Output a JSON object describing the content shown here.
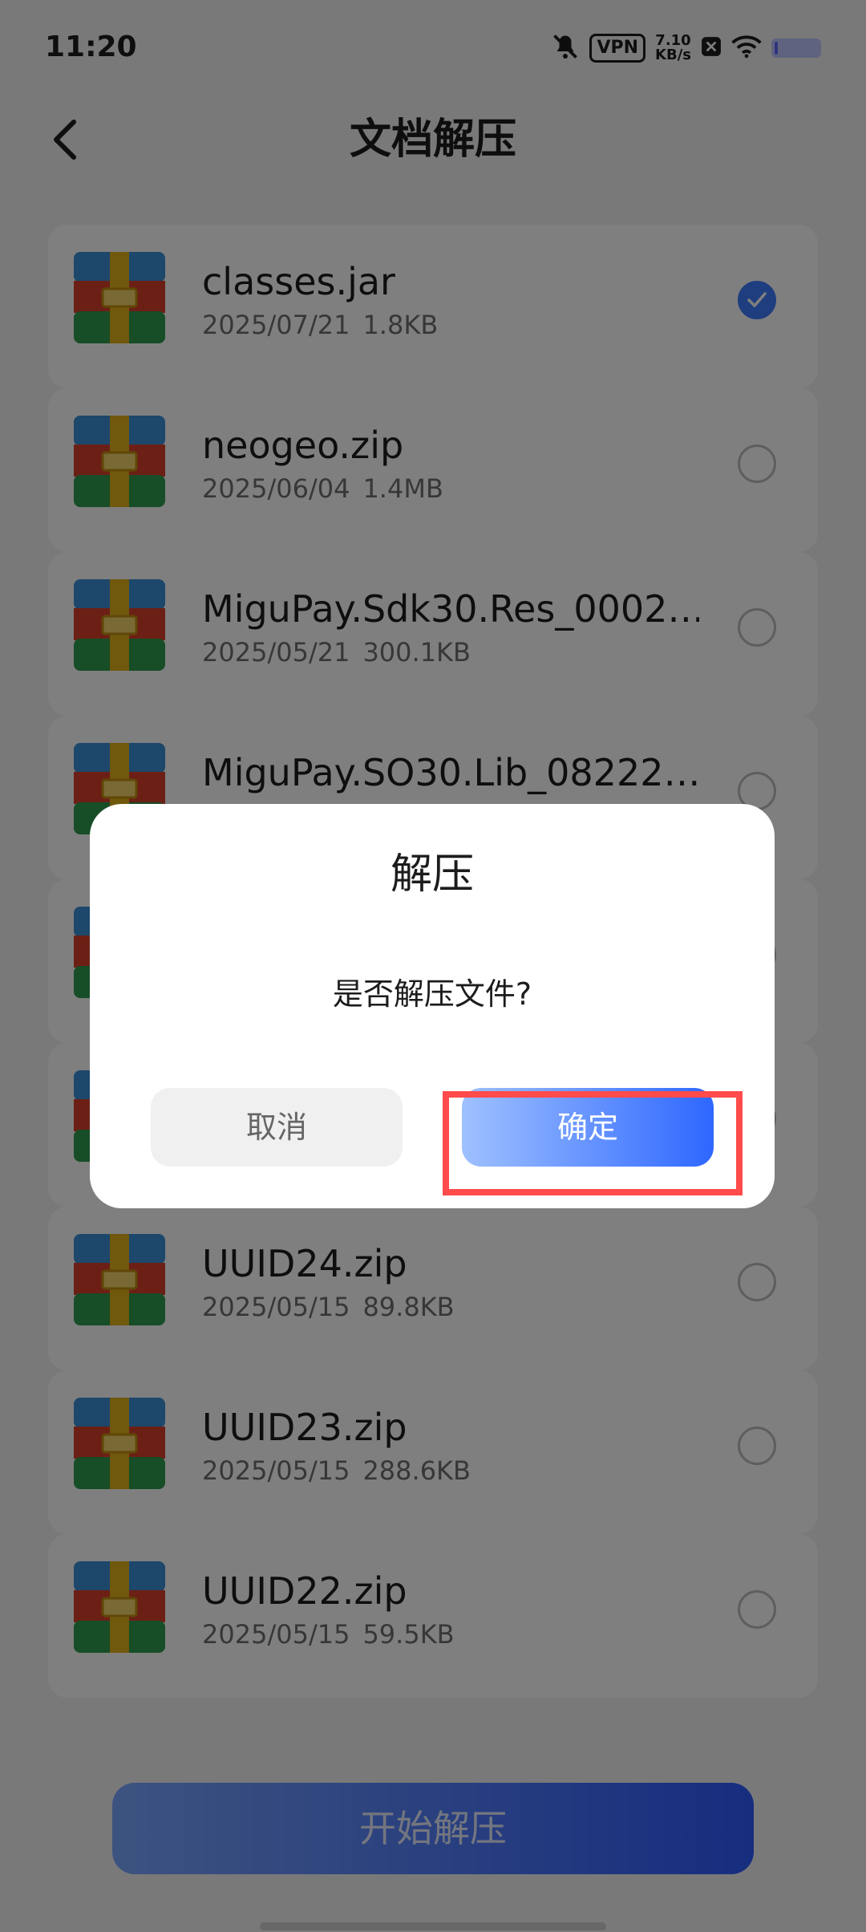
{
  "status_bar": {
    "time": "11:20",
    "vpn": "VPN",
    "speed_value": "7.10",
    "speed_unit": "KB/s",
    "icons": [
      "mute-icon",
      "vpn-badge",
      "speed-readout",
      "x-icon",
      "wifi-icon",
      "battery-icon"
    ]
  },
  "header": {
    "title": "文档解压",
    "back_icon": "chevron-left-icon"
  },
  "files": [
    {
      "name": "classes.jar",
      "date": "2025/07/21",
      "size": "1.8KB",
      "selected": true
    },
    {
      "name": "neogeo.zip",
      "date": "2025/06/04",
      "size": "1.4MB",
      "selected": false
    },
    {
      "name": "MiguPay.Sdk30.Res_0002…",
      "date": "2025/05/21",
      "size": "300.1KB",
      "selected": false
    },
    {
      "name": "MiguPay.SO30.Lib_08222…",
      "date": "",
      "size": "",
      "selected": false
    },
    {
      "name": "",
      "date": "",
      "size": "",
      "selected": false
    },
    {
      "name": "",
      "date": "",
      "size": "",
      "selected": false
    },
    {
      "name": "UUID24.zip",
      "date": "2025/05/15",
      "size": "89.8KB",
      "selected": false
    },
    {
      "name": "UUID23.zip",
      "date": "2025/05/15",
      "size": "288.6KB",
      "selected": false
    },
    {
      "name": "UUID22.zip",
      "date": "2025/05/15",
      "size": "59.5KB",
      "selected": false
    }
  ],
  "bottom": {
    "start_label": "开始解压"
  },
  "dialog": {
    "title": "解压",
    "message": "是否解压文件?",
    "cancel_label": "取消",
    "confirm_label": "确定"
  },
  "colors": {
    "accent": "#3f7cff",
    "highlight": "#ff4b4b",
    "overlay": "#000000"
  }
}
